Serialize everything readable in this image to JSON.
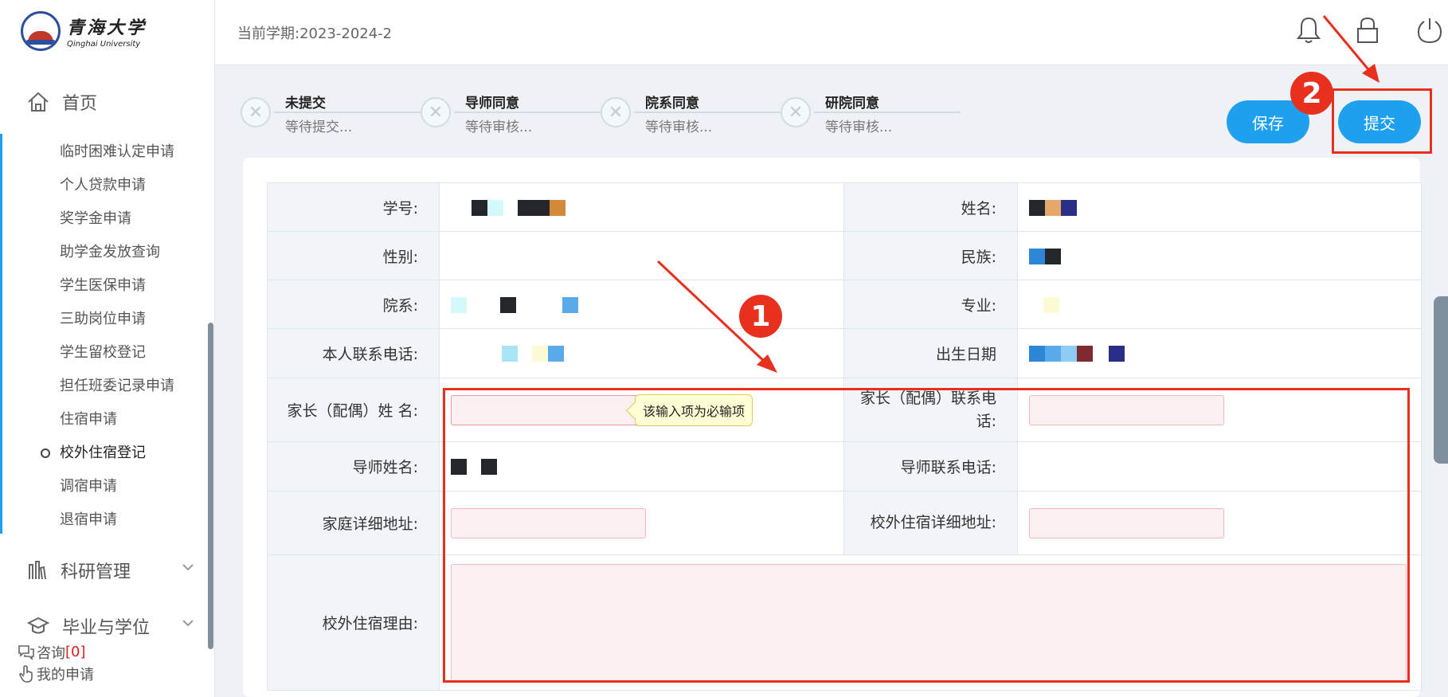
{
  "logo": {
    "name_cn": "青海大学",
    "name_en": "Qinghai University"
  },
  "sidebar": {
    "home": "首页",
    "sub_items": [
      "临时困难认定申请",
      "个人贷款申请",
      "奖学金申请",
      "助学金发放查询",
      "学生医保申请",
      "三助岗位申请",
      "学生留校登记",
      "担任班委记录申请",
      "住宿申请",
      "校外住宿登记",
      "调宿申请",
      "退宿申请"
    ],
    "active_item": "校外住宿登记",
    "groups": [
      "科研管理",
      "毕业与学位"
    ],
    "consult_label": "咨询",
    "consult_count": "[0]",
    "my_apply": "我的申请"
  },
  "header": {
    "semester": "当前学期:2023-2024-2",
    "icons": [
      "bell-icon",
      "lock-icon",
      "power-icon"
    ]
  },
  "steps": [
    {
      "title": "未提交",
      "desc": "等待提交..."
    },
    {
      "title": "导师同意",
      "desc": "等待审核..."
    },
    {
      "title": "院系同意",
      "desc": "等待审核..."
    },
    {
      "title": "研院同意",
      "desc": "等待审核..."
    }
  ],
  "actions": {
    "save": "保存",
    "submit": "提交"
  },
  "annotations": {
    "badge1": "1",
    "badge2": "2",
    "accent": "#e8301e"
  },
  "form": {
    "student_id_label": "学号:",
    "name_label": "姓名:",
    "gender_label": "性别:",
    "ethnicity_label": "民族:",
    "dept_label": "院系:",
    "major_label": "专业:",
    "phone_label": "本人联系电话:",
    "birth_label": "出生日期",
    "parent_name_label": "家长（配偶）姓 名:",
    "parent_phone_label": "家长（配偶）联系电话:",
    "tutor_name_label": "导师姓名:",
    "tutor_phone_label": "导师联系电话:",
    "home_addr_label": "家庭详细地址:",
    "offcampus_addr_label": "校外住宿详细地址:",
    "reason_label": "校外住宿理由:",
    "required_tip": "该输入项为必输项"
  },
  "colors": {
    "primary": "#1ea0ee",
    "input_bg": "#fdf0f1"
  }
}
